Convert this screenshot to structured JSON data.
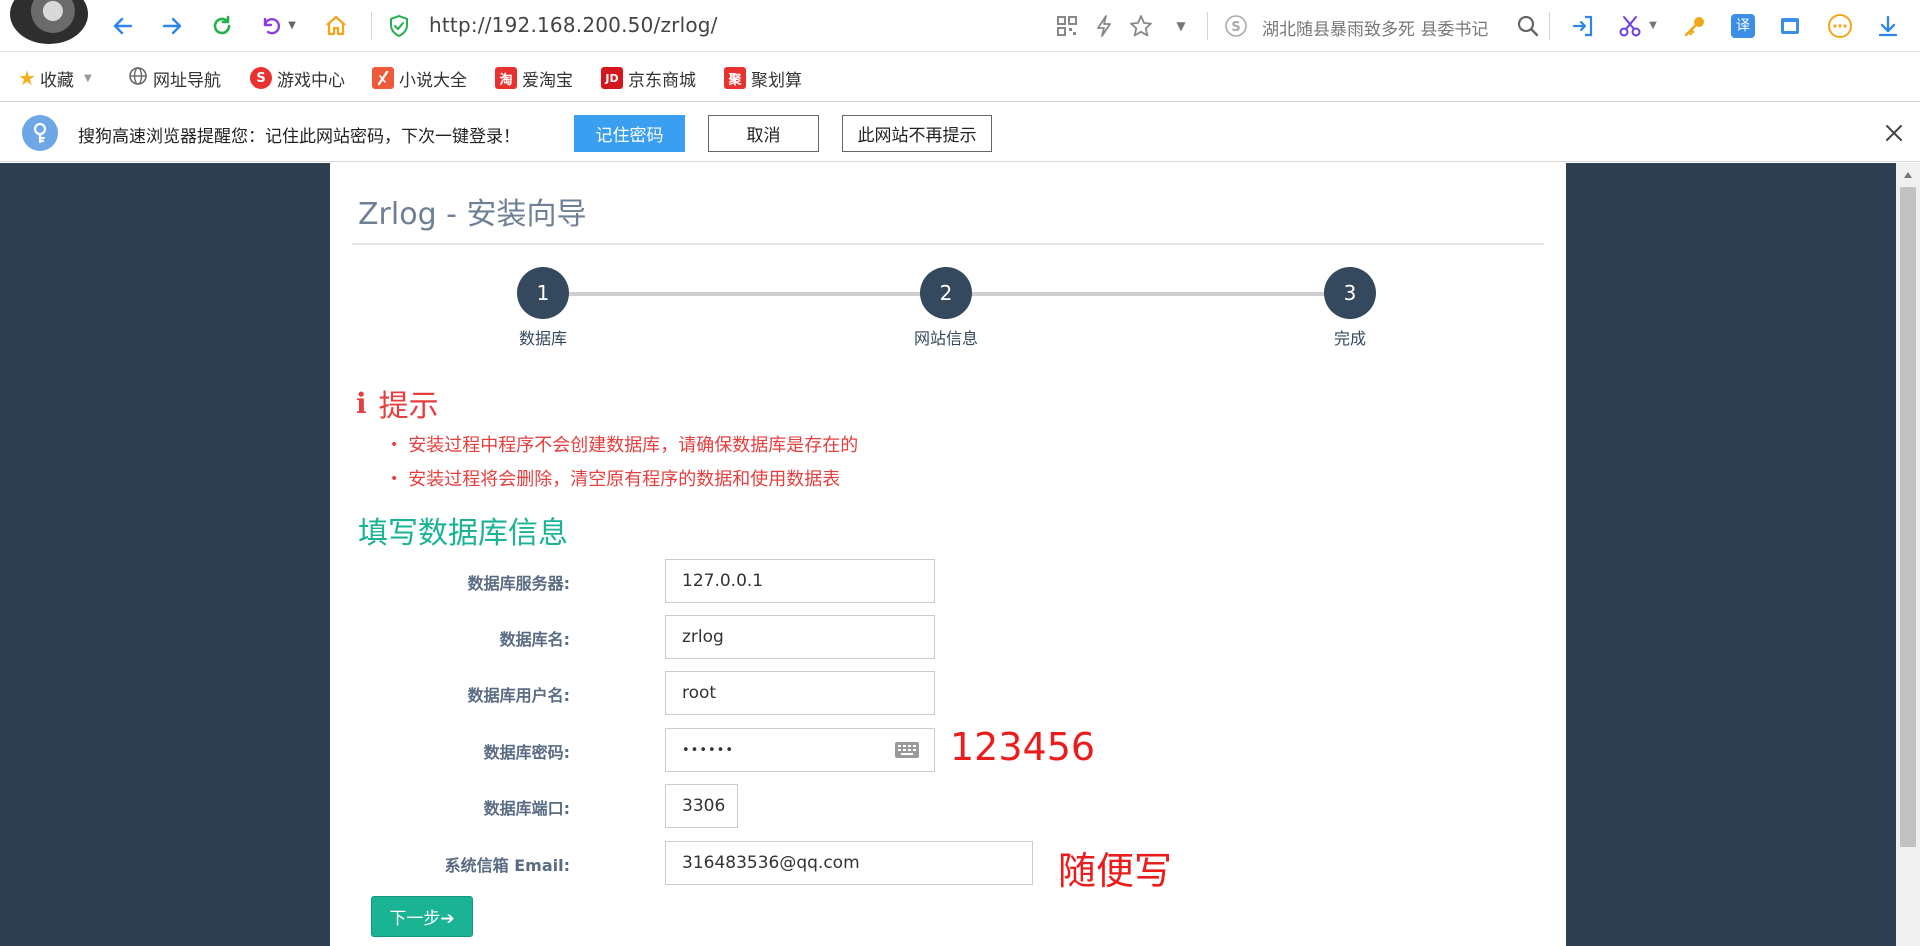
{
  "browser": {
    "url": "http://192.168.200.50/zrlog/",
    "search_text": "湖北随县暴雨致多死 县委书记"
  },
  "bookmarks": [
    {
      "label": "收藏"
    },
    {
      "label": "网址导航"
    },
    {
      "label": "游戏中心"
    },
    {
      "label": "小说大全"
    },
    {
      "label": "爱淘宝"
    },
    {
      "label": "京东商城"
    },
    {
      "label": "聚划算"
    }
  ],
  "bookmark_icons": {
    "games": "S",
    "taobao": "淘",
    "jd": "JD",
    "juhuasuan": "聚"
  },
  "password_bar": {
    "message": "搜狗高速浏览器提醒您：记住此网站密码，下次一键登录！",
    "remember_label": "记住密码",
    "cancel_label": "取消",
    "never_label": "此网站不再提示"
  },
  "page": {
    "title": "Zrlog - 安装向导",
    "steps": [
      {
        "number": "1",
        "label": "数据库"
      },
      {
        "number": "2",
        "label": "网站信息"
      },
      {
        "number": "3",
        "label": "完成"
      }
    ],
    "hint_title": "提示",
    "hints": [
      "安装过程中程序不会创建数据库，请确保数据库是存在的",
      "安装过程将会删除，清空原有程序的数据和使用数据表"
    ],
    "section_title": "填写数据库信息",
    "fields": {
      "host": {
        "label": "数据库服务器:",
        "value": "127.0.0.1"
      },
      "dbname": {
        "label": "数据库名:",
        "value": "zrlog"
      },
      "user": {
        "label": "数据库用户名:",
        "value": "root"
      },
      "password": {
        "label": "数据库密码:",
        "value": "••••••"
      },
      "port": {
        "label": "数据库端口:",
        "value": "3306"
      },
      "email": {
        "label": "系统信箱 Email:",
        "value": "316483536@qq.com"
      }
    },
    "annotations": {
      "password_note": "123456",
      "email_note": "随便写"
    },
    "next_label": "下一步➔"
  },
  "colors": {
    "page_bg": "#2c3e50",
    "accent_green": "#1ab394",
    "step_circle": "#34495e",
    "hint_red": "#e53f3f",
    "annotation_red": "#ea1c1c",
    "remember_blue": "#3a9ff0"
  }
}
